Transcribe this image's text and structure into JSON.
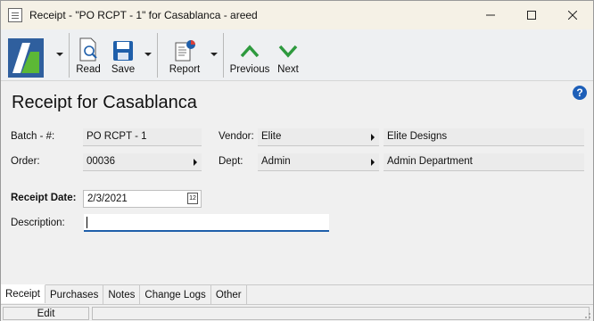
{
  "window": {
    "title": "Receipt - \"PO RCPT - 1\" for Casablanca - areed"
  },
  "toolbar": {
    "read_label": "Read",
    "save_label": "Save",
    "report_label": "Report",
    "previous_label": "Previous",
    "next_label": "Next"
  },
  "page": {
    "title": "Receipt for Casablanca",
    "help_glyph": "?"
  },
  "fields": {
    "batch_label": "Batch - #:",
    "batch_value": "PO RCPT - 1",
    "order_label": "Order:",
    "order_value": "00036",
    "vendor_label": "Vendor:",
    "vendor_value": "Elite",
    "vendor_name": "Elite Designs",
    "dept_label": "Dept:",
    "dept_value": "Admin",
    "dept_name": "Admin Department",
    "receipt_date_label": "Receipt Date:",
    "receipt_date_value": "2/3/2021",
    "calendar_glyph": "12",
    "description_label": "Description:",
    "description_value": ""
  },
  "tabs": [
    {
      "label": "Receipt"
    },
    {
      "label": "Purchases"
    },
    {
      "label": "Notes"
    },
    {
      "label": "Change Logs"
    },
    {
      "label": "Other"
    }
  ],
  "status": {
    "mode": "Edit"
  },
  "colors": {
    "accent_blue": "#1f5faa",
    "nav_green": "#2e9a3e",
    "logo_blue": "#2f5f9e",
    "logo_green": "#5cb836"
  }
}
